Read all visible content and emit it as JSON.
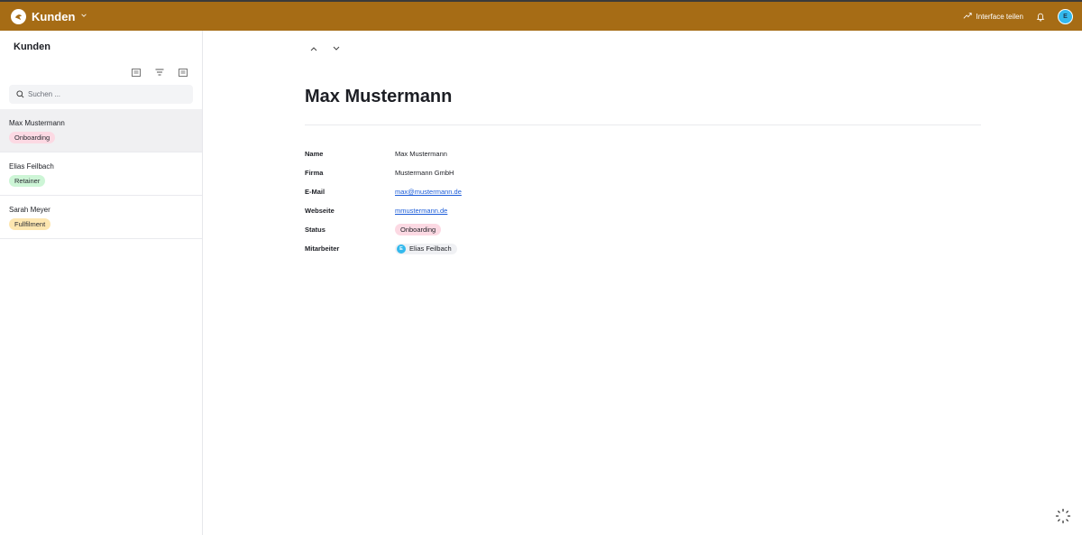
{
  "app": {
    "title": "Kunden",
    "brand_color": "#a66c15",
    "share_label": "Interface teilen",
    "user_initial": "E"
  },
  "sidebar": {
    "title": "Kunden",
    "search_placeholder": "Suchen ...",
    "items": [
      {
        "name": "Max Mustermann",
        "tag": "Onboarding",
        "tag_color": "#fcd9e3",
        "active": true
      },
      {
        "name": "Elias Feilbach",
        "tag": "Retainer",
        "tag_color": "#cdf5d6",
        "active": false
      },
      {
        "name": "Sarah Meyer",
        "tag": "Fullfilment",
        "tag_color": "#fde6b0",
        "active": false
      }
    ]
  },
  "record": {
    "title": "Max Mustermann",
    "fields": {
      "name_label": "Name",
      "name_value": "Max Mustermann",
      "firma_label": "Firma",
      "firma_value": "Mustermann GmbH",
      "email_label": "E-Mail",
      "email_value": "max@mustermann.de",
      "web_label": "Webseite",
      "web_value": "mmustermann.de",
      "status_label": "Status",
      "status_value": "Onboarding",
      "mitarbeiter_label": "Mitarbeiter",
      "mitarbeiter_initial": "E",
      "mitarbeiter_value": "Elias Feilbach"
    }
  }
}
